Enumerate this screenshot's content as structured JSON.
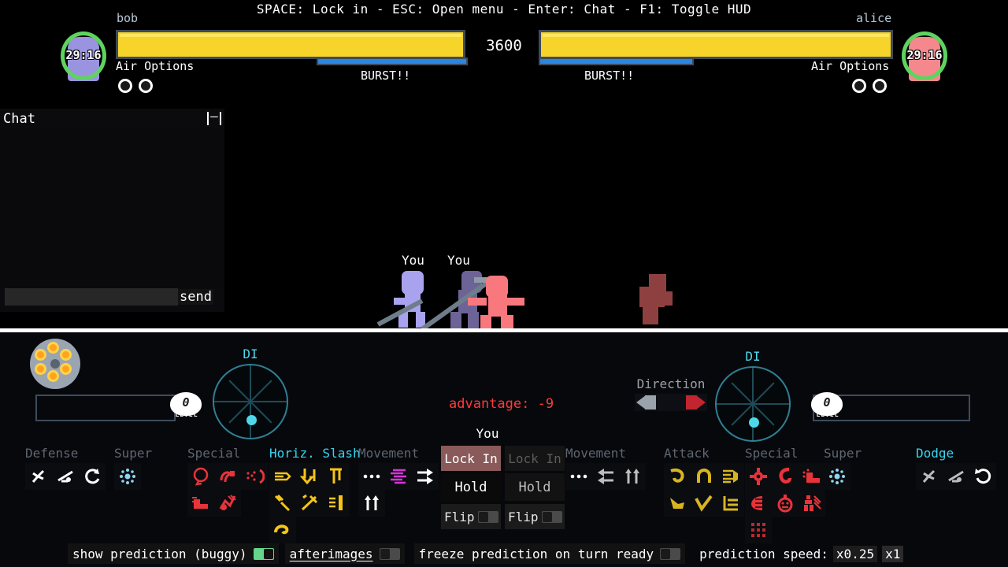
{
  "hud": {
    "hint": "SPACE: Lock in - ESC: Open menu - Enter: Chat - F1: Toggle HUD",
    "center_timer": "3600",
    "left": {
      "name": "bob",
      "portrait_timer": "29:16",
      "hp_percent": 100,
      "burst_label": "BURST!!",
      "burst_percent": 100,
      "air_options_label": "Air Options",
      "air_options_count": 2
    },
    "right": {
      "name": "alice",
      "portrait_timer": "29:16",
      "hp_percent": 100,
      "burst_label": "BURST!!",
      "burst_percent": 100,
      "air_options_label": "Air Options",
      "air_options_count": 2
    }
  },
  "chat": {
    "title": "Chat",
    "minimize_icon": "minimize-icon",
    "input_value": "",
    "input_placeholder": "",
    "send_label": "send",
    "messages": []
  },
  "arena": {
    "tag_a": "You",
    "tag_b": "You"
  },
  "timeline": {
    "tick_count": 13,
    "tick_spacing": 100
  },
  "left_panel": {
    "di_label": "DI",
    "level_number": "0",
    "level_text": "LEVEL",
    "level_percent": 0,
    "categories": [
      {
        "label": "Defense",
        "highlight": false,
        "icons": [
          "kick-defense-icon",
          "sweep-defense-icon",
          "reversal-icon"
        ]
      },
      {
        "label": "Super",
        "highlight": false,
        "icons": [
          "super-burst-icon"
        ]
      },
      {
        "label": "Special",
        "highlight": false,
        "icons": [
          "ring-special-icon",
          "spiral-special-icon",
          "dust-special-icon",
          "slam-special-icon",
          "rush-special-icon"
        ]
      },
      {
        "label": "Horiz. Slash",
        "highlight": true,
        "icons": [
          "thrust-slash-icon",
          "down-slash-icon",
          "up-slash-icon",
          "wind-slash-icon",
          "cross-slash-icon",
          "hand-slash-icon",
          "curl-slash-icon"
        ]
      },
      {
        "label": "Movement",
        "highlight": false,
        "icons": [
          "dots-move-icon",
          "dash-lines-icon",
          "double-arrow-right-icon",
          "double-up-arrow-icon"
        ]
      }
    ]
  },
  "center_panel": {
    "advantage_label": "advantage: -9",
    "you_label": "You",
    "columns": [
      {
        "lock_label": "Lock In",
        "lock_active": true,
        "hold_label": "Hold",
        "flip_label": "Flip",
        "flip_on": false
      },
      {
        "lock_label": "Lock In",
        "lock_active": false,
        "hold_label": "Hold",
        "flip_label": "Flip",
        "flip_on": false
      }
    ]
  },
  "right_panel": {
    "di_label": "DI",
    "direction_label": "Direction",
    "level_number": "0",
    "level_text": "LEVEL",
    "level_percent": 0,
    "categories": [
      {
        "label": "Movement",
        "highlight": false,
        "icons": [
          "dots-move-icon",
          "dash-left-icon",
          "double-up-arrow-icon"
        ]
      },
      {
        "label": "Attack",
        "highlight": false,
        "icons": [
          "hook-attack-icon",
          "arc-attack-icon",
          "punch-attack-icon",
          "kick-attack-icon",
          "check-attack-icon",
          "bracket-attack-icon"
        ]
      },
      {
        "label": "Special",
        "highlight": false,
        "icons": [
          "gear-special-icon",
          "whip-special-icon",
          "slam-special-icon",
          "shield-special-icon",
          "bomb-special-icon",
          "clash-special-icon",
          "grid-special-icon"
        ]
      },
      {
        "label": "Super",
        "highlight": false,
        "icons": [
          "super-burst-icon"
        ]
      },
      {
        "label": "Dodge",
        "highlight": true,
        "icons": [
          "dodge-back-icon",
          "dodge-roll-icon",
          "dodge-spin-icon"
        ]
      }
    ]
  },
  "options": {
    "show_prediction": {
      "label": "show prediction (buggy)",
      "on": true,
      "underlined": false
    },
    "afterimages": {
      "label": "afterimages",
      "on": false,
      "underlined": true
    },
    "freeze_prediction": {
      "label": "freeze prediction on turn ready",
      "on": false,
      "underlined": false
    },
    "prediction_speed": {
      "label": "prediction speed:",
      "options": [
        "x0.25",
        "x1"
      ],
      "selected": "x1"
    }
  },
  "colors": {
    "hp": "#f7d42a",
    "burst": "#2a86e0",
    "accent_cyan": "#38d5ef",
    "advantage_red": "#ff3a3a",
    "toggle_on": "#63d68a",
    "lock_active": "#8a5a5a",
    "special_red": "#e8333a",
    "attack_yellow": "#d8b520",
    "slash_yellow": "#f5c518"
  }
}
